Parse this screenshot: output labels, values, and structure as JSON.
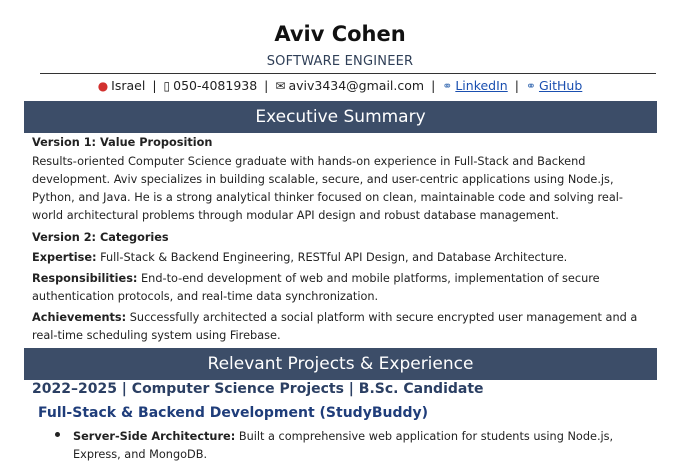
{
  "header": {
    "name": "Aviv Cohen",
    "role": "SOFTWARE ENGINEER"
  },
  "contact": {
    "location": "Israel",
    "phone": "050-4081938",
    "email": "aviv3434@gmail.com",
    "linkedin": "LinkedIn",
    "github": "GitHub",
    "separator": "|",
    "icons": [
      "pin-icon",
      "phone-icon",
      "email-icon",
      "link-icon",
      "link-icon"
    ]
  },
  "executive_summary": {
    "title": "Executive Summary",
    "version1_heading": "Version 1: Value Proposition",
    "version1_text": "Results-oriented Computer Science graduate with hands-on experience in Full-Stack and Backend development. Aviv specializes in building scalable, secure, and user-centric applications using Node.js, Python, and Java. He is a strong analytical thinker focused on clean, maintainable code and solving real-world architectural problems through modular API design and robust database management.",
    "version2_heading": "Version 2: Categories",
    "expertise_label": "Expertise:",
    "expertise_text": " Full-Stack & Backend Engineering, RESTful API Design, and Database Architecture.",
    "responsibilities_label": "Responsibilities:",
    "responsibilities_text": " End-to-end development of web and mobile platforms, implementation of secure authentication protocols, and real-time data synchronization.",
    "achievements_label": "Achievements:",
    "achievements_text": " Successfully architected a social platform with secure encrypted user management and a real-time scheduling system using Firebase."
  },
  "projects": {
    "title": "Relevant Projects & Experience",
    "period_heading": "2022–2025 | Computer Science Projects | B.Sc. Candidate",
    "project_title": "Full-Stack & Backend Development (StudyBuddy)",
    "bullets": [
      {
        "label": "Server-Side Architecture:",
        "text": " Built a comprehensive web application for students using Node.js, Express, and MongoDB."
      }
    ]
  },
  "colors": {
    "section_bar": "#3c4d68",
    "heading_blue": "#2b3f63",
    "link_blue": "#1a4fb0"
  }
}
